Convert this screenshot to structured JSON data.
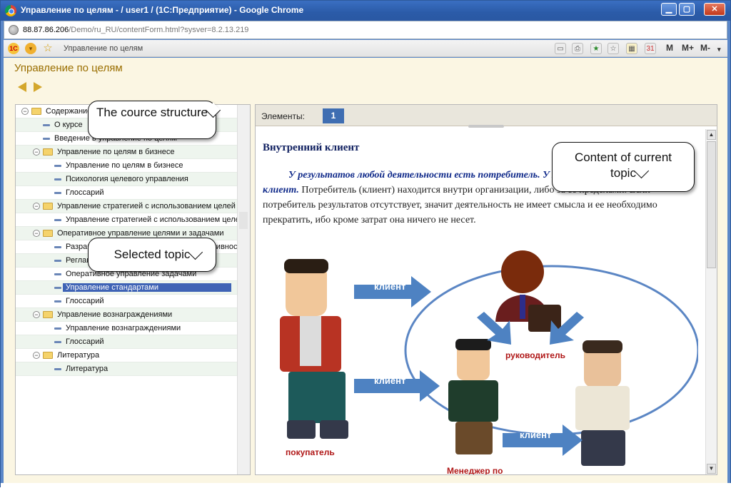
{
  "window": {
    "title": "Управление по целям - / user1 / (1С:Предприятие) - Google Chrome",
    "min_label": "▁",
    "max_label": "▢",
    "close_label": "✕"
  },
  "address": {
    "host": "88.87.86.206",
    "path": "/Demo/ru_RU/contentForm.html?sysver=8.2.13.219"
  },
  "toolbar": {
    "breadcrumb": "Управление по целям",
    "m_label": "M",
    "mplus_label": "M+",
    "mminus_label": "M-",
    "more_label": "▾"
  },
  "page": {
    "title": "Управление по целям"
  },
  "tree": {
    "items": [
      {
        "label": "Содержание",
        "level": 0,
        "type": "folder"
      },
      {
        "label": "О курсе",
        "level": 1,
        "type": "doc"
      },
      {
        "label": "Введение в управление по целям",
        "level": 1,
        "type": "doc"
      },
      {
        "label": "Управление по целям в бизнесе",
        "level": 1,
        "type": "folder"
      },
      {
        "label": "Управление по целям в бизнесе",
        "level": 2,
        "type": "doc"
      },
      {
        "label": "Психология целевого управления",
        "level": 2,
        "type": "doc"
      },
      {
        "label": "Глоссарий",
        "level": 2,
        "type": "doc"
      },
      {
        "label": "Управление стратегией с использованием целей",
        "level": 1,
        "type": "folder"
      },
      {
        "label": "Управление стратегией с использованием целей",
        "level": 2,
        "type": "doc"
      },
      {
        "label": "Оперативное управление целями и задачами",
        "level": 1,
        "type": "folder"
      },
      {
        "label": "Разработка целей и показателей эффективности",
        "level": 2,
        "type": "doc"
      },
      {
        "label": "Регламент",
        "level": 2,
        "type": "doc"
      },
      {
        "label": "Оперативное управление задачами",
        "level": 2,
        "type": "doc"
      },
      {
        "label": "Управление стандартами",
        "level": 2,
        "type": "doc",
        "selected": true
      },
      {
        "label": "Глоссарий",
        "level": 2,
        "type": "doc"
      },
      {
        "label": "Управление вознаграждениями",
        "level": 1,
        "type": "folder"
      },
      {
        "label": "Управление вознаграждениями",
        "level": 2,
        "type": "doc"
      },
      {
        "label": "Глоссарий",
        "level": 2,
        "type": "doc"
      },
      {
        "label": "Литература",
        "level": 1,
        "type": "folder"
      },
      {
        "label": "Литература",
        "level": 2,
        "type": "doc"
      }
    ]
  },
  "elements": {
    "label": "Элементы:",
    "page_number": "1"
  },
  "article": {
    "heading": "Внутренний клиент",
    "lead": "У результатов любой деятельности есть потребитель. У любого сотрудника есть свой клиент.",
    "body": " Потребитель (клиент) находится внутри организации, либо за ее пределами. Если потребитель результатов отсутствует, значит деятельность не имеет смысла и ее необходимо  прекратить, ибо кроме затрат она ничего не несет."
  },
  "illustration": {
    "arrow_label": "клиент",
    "roles": {
      "buyer": "покупатель",
      "head": "руководитель",
      "manager": "Менеджер по"
    }
  },
  "callouts": {
    "structure": "The cource structure",
    "content": "Content of current topic",
    "selected": "Selected topic"
  }
}
